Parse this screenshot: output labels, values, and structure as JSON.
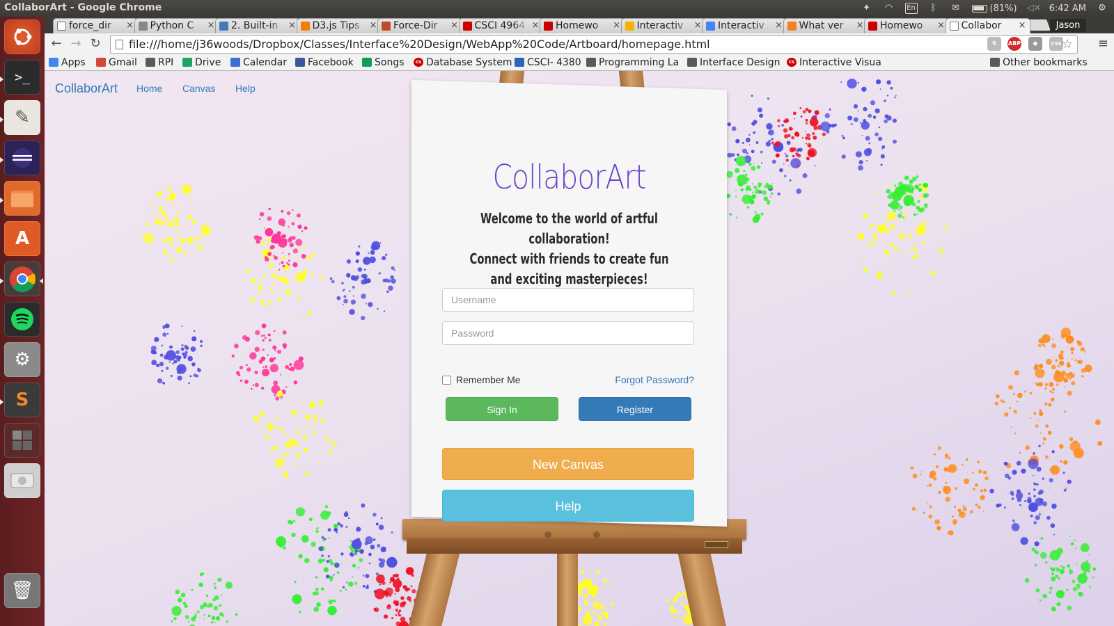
{
  "window": {
    "title": "CollaborArt - Google Chrome"
  },
  "panel": {
    "lang": "En",
    "battery": "(81%)",
    "time": "6:42 AM"
  },
  "launcher": {
    "icons": [
      "ubuntu-dash-icon",
      "terminal-icon",
      "text-editor-icon",
      "eclipse-icon",
      "files-icon",
      "software-center-icon",
      "chrome-icon",
      "spotify-icon",
      "system-settings-icon",
      "sublime-text-icon",
      "workspace-switcher-icon",
      "disk-icon",
      "trash-icon"
    ]
  },
  "tabs": [
    {
      "label": "force_dir",
      "fav": "doc",
      "color": "#ffffff"
    },
    {
      "label": "Python C",
      "fav": "py",
      "color": "#888888"
    },
    {
      "label": "2. Built-in",
      "fav": "py",
      "color": "#3f7cb8"
    },
    {
      "label": "D3.js Tips",
      "fav": "blogger",
      "color": "#f57d00"
    },
    {
      "label": "Force-Dir",
      "fav": "d3",
      "color": "#c04a2c"
    },
    {
      "label": "CSCI 4964",
      "fav": "cs",
      "color": "#cc0000"
    },
    {
      "label": "Homewo",
      "fav": "cs",
      "color": "#cc0000"
    },
    {
      "label": "Interactiv",
      "fav": "slides",
      "color": "#f4b400"
    },
    {
      "label": "Interactiv",
      "fav": "docs",
      "color": "#4285f4"
    },
    {
      "label": "What ver",
      "fav": "so",
      "color": "#f48024"
    },
    {
      "label": "Homewo",
      "fav": "cs",
      "color": "#cc0000"
    },
    {
      "label": "Collabor",
      "fav": "doc",
      "color": "#ffffff",
      "active": true
    }
  ],
  "profile": "Jason",
  "url": "file:///home/j36woods/Dropbox/Classes/Interface%20Design/WebApp%20Code/Artboard/homepage.html",
  "bookmarks": [
    {
      "label": "Apps",
      "icon": "apps-icon"
    },
    {
      "label": "Gmail",
      "icon": "gmail-icon"
    },
    {
      "label": "RPI",
      "icon": "folder-icon"
    },
    {
      "label": "Drive",
      "icon": "drive-icon"
    },
    {
      "label": "Calendar",
      "icon": "calendar-icon"
    },
    {
      "label": "Facebook",
      "icon": "facebook-icon"
    },
    {
      "label": "Songs",
      "icon": "sheets-icon"
    },
    {
      "label": "Database System",
      "icon": "cs-icon"
    },
    {
      "label": "CSCI- 4380",
      "icon": "p-icon"
    },
    {
      "label": "Programming La",
      "icon": "folder-icon"
    },
    {
      "label": "Interface Design",
      "icon": "folder-icon"
    },
    {
      "label": "Interactive Visua",
      "icon": "cs-icon"
    }
  ],
  "other_bookmarks": "Other bookmarks",
  "site": {
    "brand": "CollaborArt",
    "nav": [
      "Home",
      "Canvas",
      "Help"
    ],
    "logo": "CollaborArt",
    "welcome": [
      "Welcome to the world of artful collaboration!",
      "Connect with friends to create fun",
      "and exciting masterpieces!"
    ],
    "username_placeholder": "Username",
    "password_placeholder": "Password",
    "remember": "Remember Me",
    "forgot": "Forgot Password?",
    "signin": "Sign In",
    "register": "Register",
    "new_canvas": "New Canvas",
    "help": "Help"
  }
}
